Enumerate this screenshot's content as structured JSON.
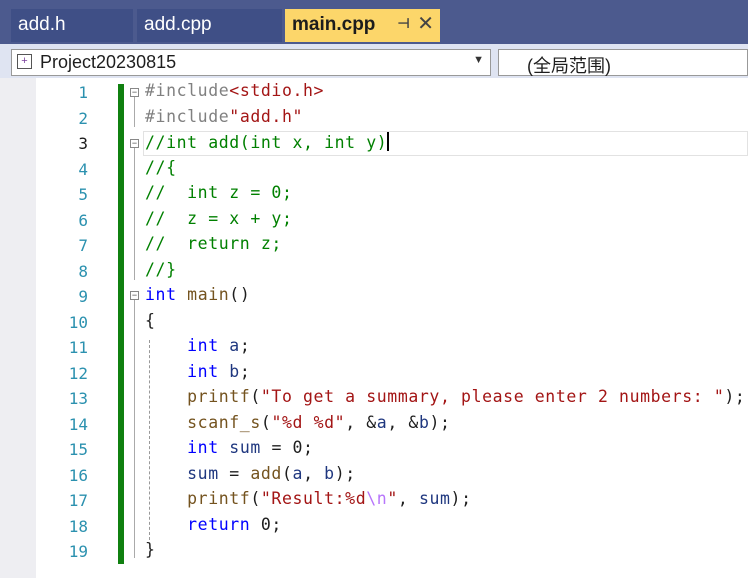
{
  "tabs": [
    {
      "label": "add.h"
    },
    {
      "label": "add.cpp"
    },
    {
      "label": "main.cpp",
      "pin": "⊣",
      "close": "✕"
    }
  ],
  "nav": {
    "project": "Project20230815",
    "scope": "(全局范围)"
  },
  "lines": [
    {
      "n": "1",
      "tokens": [
        {
          "t": "#include",
          "c": "pp"
        },
        {
          "t": "<stdio.h>",
          "c": "str"
        }
      ]
    },
    {
      "n": "2",
      "tokens": [
        {
          "t": "#include",
          "c": "pp"
        },
        {
          "t": "\"add.h\"",
          "c": "str"
        }
      ]
    },
    {
      "n": "3",
      "tokens": [
        {
          "t": "//int add(int x, int y)",
          "c": "cm"
        }
      ]
    },
    {
      "n": "4",
      "tokens": [
        {
          "t": "//{",
          "c": "cm"
        }
      ]
    },
    {
      "n": "5",
      "tokens": [
        {
          "t": "//  int z = 0;",
          "c": "cm"
        }
      ]
    },
    {
      "n": "6",
      "tokens": [
        {
          "t": "//  z = x + y;",
          "c": "cm"
        }
      ]
    },
    {
      "n": "7",
      "tokens": [
        {
          "t": "//  return z;",
          "c": "cm"
        }
      ]
    },
    {
      "n": "8",
      "tokens": [
        {
          "t": "//}",
          "c": "cm"
        }
      ]
    },
    {
      "n": "9",
      "tokens": [
        {
          "t": "int",
          "c": "kw"
        },
        {
          "t": " "
        },
        {
          "t": "main",
          "c": "fn"
        },
        {
          "t": "()"
        }
      ]
    },
    {
      "n": "10",
      "tokens": [
        {
          "t": "{"
        }
      ]
    },
    {
      "n": "11",
      "tokens": [
        {
          "t": "    "
        },
        {
          "t": "int",
          "c": "kw"
        },
        {
          "t": " "
        },
        {
          "t": "a",
          "c": "id"
        },
        {
          "t": ";"
        }
      ]
    },
    {
      "n": "12",
      "tokens": [
        {
          "t": "    "
        },
        {
          "t": "int",
          "c": "kw"
        },
        {
          "t": " "
        },
        {
          "t": "b",
          "c": "id"
        },
        {
          "t": ";"
        }
      ]
    },
    {
      "n": "13",
      "tokens": [
        {
          "t": "    "
        },
        {
          "t": "printf",
          "c": "fn"
        },
        {
          "t": "("
        },
        {
          "t": "\"To get a summary, please enter 2 numbers: \"",
          "c": "str"
        },
        {
          "t": ");"
        }
      ]
    },
    {
      "n": "14",
      "tokens": [
        {
          "t": "    "
        },
        {
          "t": "scanf_s",
          "c": "fn"
        },
        {
          "t": "("
        },
        {
          "t": "\"%d %d\"",
          "c": "str"
        },
        {
          "t": ", &"
        },
        {
          "t": "a",
          "c": "id"
        },
        {
          "t": ", &"
        },
        {
          "t": "b",
          "c": "id"
        },
        {
          "t": ");"
        }
      ]
    },
    {
      "n": "15",
      "tokens": [
        {
          "t": "    "
        },
        {
          "t": "int",
          "c": "kw"
        },
        {
          "t": " "
        },
        {
          "t": "sum",
          "c": "id"
        },
        {
          "t": " = 0;"
        }
      ]
    },
    {
      "n": "16",
      "tokens": [
        {
          "t": "    "
        },
        {
          "t": "sum",
          "c": "id"
        },
        {
          "t": " = "
        },
        {
          "t": "add",
          "c": "fn"
        },
        {
          "t": "("
        },
        {
          "t": "a",
          "c": "id"
        },
        {
          "t": ", "
        },
        {
          "t": "b",
          "c": "id"
        },
        {
          "t": ");"
        }
      ]
    },
    {
      "n": "17",
      "tokens": [
        {
          "t": "    "
        },
        {
          "t": "printf",
          "c": "fn"
        },
        {
          "t": "("
        },
        {
          "t": "\"Result:%d",
          "c": "str"
        },
        {
          "t": "\\n",
          "c": "esc"
        },
        {
          "t": "\"",
          "c": "str"
        },
        {
          "t": ", "
        },
        {
          "t": "sum",
          "c": "id"
        },
        {
          "t": ");"
        }
      ]
    },
    {
      "n": "18",
      "tokens": [
        {
          "t": "    "
        },
        {
          "t": "return",
          "c": "kw"
        },
        {
          "t": " 0;"
        }
      ]
    },
    {
      "n": "19",
      "tokens": [
        {
          "t": "}"
        }
      ]
    }
  ],
  "current_line": "3",
  "colors": {
    "tab_active": "#fcd66a",
    "tabbar": "#4c5a8e",
    "change_bar": "#108010"
  }
}
